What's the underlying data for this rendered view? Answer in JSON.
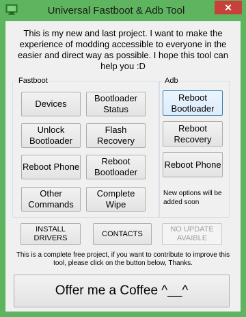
{
  "window": {
    "title": "Universal Fastboot & Adb Tool",
    "close_glyph": "✕",
    "icon": "monitor-icon",
    "accent_color": "#5fb55f",
    "close_color": "#c7403a"
  },
  "intro_text": "This is my new and last project. I want to make the experience of modding accessible to everyone in the easier and direct way as possible. I hope this tool can help you :D",
  "fastboot": {
    "label": "Fastboot",
    "buttons": {
      "devices": "Devices",
      "bootloader_status": "Bootloader Status",
      "unlock_bootloader": "Unlock Bootloader",
      "flash_recovery": "Flash Recovery",
      "reboot_phone": "Reboot Phone",
      "reboot_bootloader": "Reboot Bootloader",
      "other_commands": "Other Commands",
      "complete_wipe": "Complete Wipe"
    }
  },
  "adb": {
    "label": "Adb",
    "buttons": {
      "reboot_bootloader": "Reboot Bootloader",
      "reboot_recovery": "Reboot Recovery",
      "reboot_phone": "Reboot Phone"
    },
    "note": "New options will be added soon"
  },
  "bottom_buttons": {
    "install_drivers": "INSTALL DRIVERS",
    "contacts": "CONTACTS",
    "no_update": "NO UPDATE AVAIBLE"
  },
  "footer_text": "This is a complete free project, if you want to contribute to improve this tool, please click on the button below, Thanks.",
  "coffee_button": "Offer me a Coffee ^__^"
}
